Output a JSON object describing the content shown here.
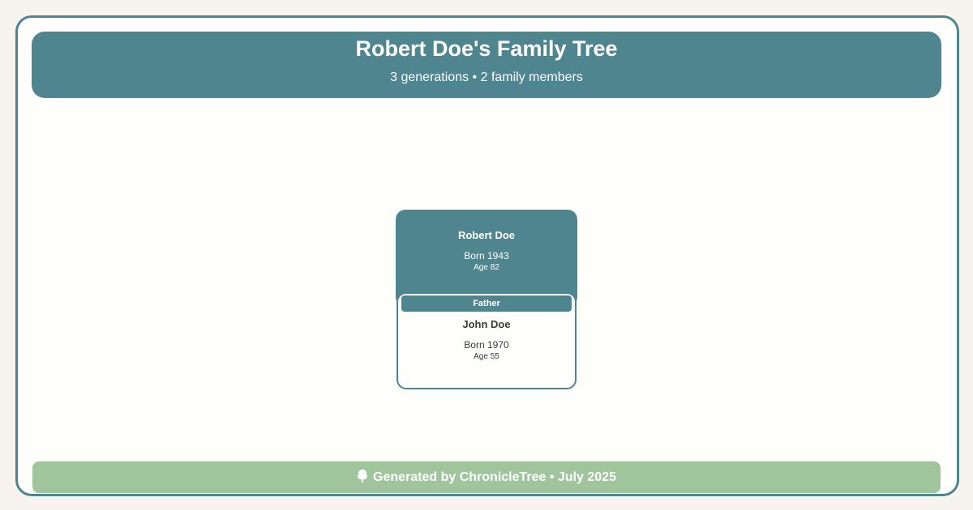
{
  "header": {
    "title": "Robert Doe's Family Tree",
    "subtitle": "3 generations • 2 family members"
  },
  "root_person": {
    "name": "Robert Doe",
    "born": "Born 1943",
    "age": "Age 82"
  },
  "child_person": {
    "relation": "Father",
    "name": "John Doe",
    "born": "Born 1970",
    "age": "Age 55"
  },
  "footer": {
    "icon": "tree-icon",
    "text": "Generated by ChronicleTree • July 2025"
  },
  "colors": {
    "primary": "#4f858f",
    "footer": "#a0c59d",
    "canvas": "#fefefb",
    "page": "#f7f3ef"
  }
}
